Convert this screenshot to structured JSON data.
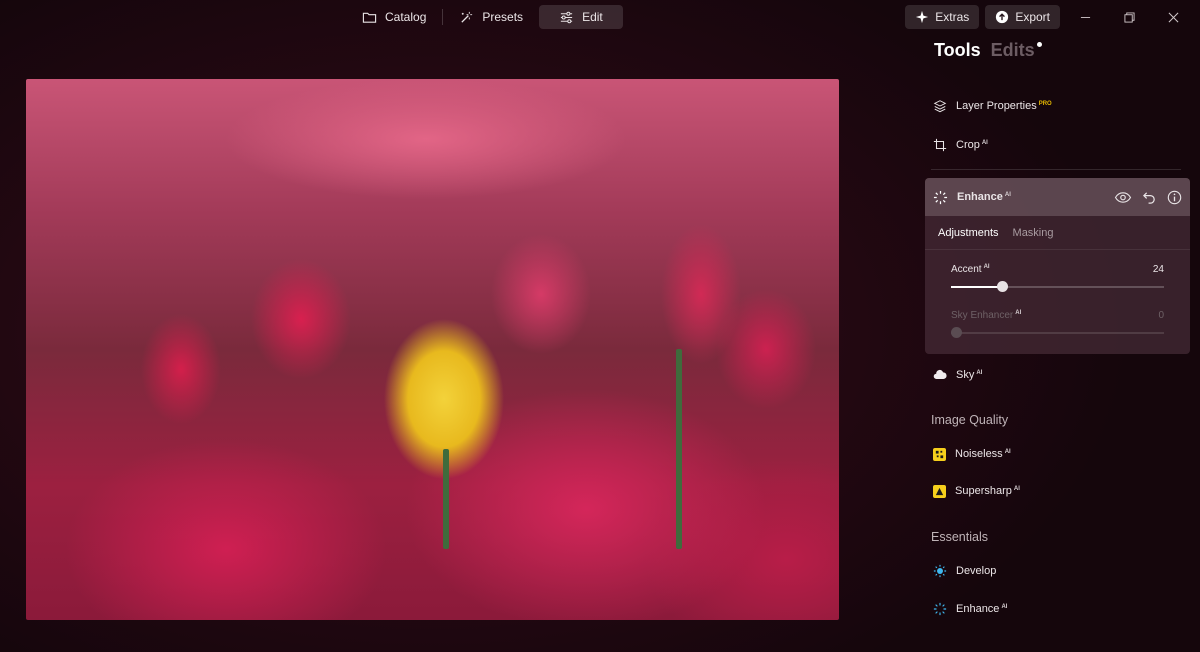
{
  "topnav": {
    "catalog": "Catalog",
    "presets": "Presets",
    "edit": "Edit"
  },
  "window": {
    "extras": "Extras",
    "export": "Export"
  },
  "panel": {
    "tab_tools": "Tools",
    "tab_edits": "Edits",
    "layer_properties": {
      "label": "Layer Properties",
      "badge": "PRO"
    },
    "crop": {
      "label": "Crop",
      "badge": "AI"
    },
    "enhance_card": {
      "title": "Enhance",
      "badge": "AI",
      "tab_adjustments": "Adjustments",
      "tab_masking": "Masking",
      "accent": {
        "label": "Accent",
        "badge": "AI",
        "value": "24",
        "fraction": 0.24
      },
      "sky_enhancer": {
        "label": "Sky Enhancer",
        "badge": "AI",
        "value": "0",
        "fraction": 0
      }
    },
    "sky": {
      "label": "Sky",
      "badge": "AI"
    },
    "image_quality": {
      "title": "Image Quality",
      "noiseless": {
        "label": "Noiseless",
        "badge": "AI"
      },
      "supersharp": {
        "label": "Supersharp",
        "badge": "AI"
      }
    },
    "essentials": {
      "title": "Essentials",
      "develop": {
        "label": "Develop"
      },
      "enhance": {
        "label": "Enhance",
        "badge": "AI"
      }
    }
  },
  "colors": {
    "accent_yellow": "#f6cf1c",
    "pro_badge": "#e6b800",
    "develop_icon": "#3fb8f0"
  }
}
